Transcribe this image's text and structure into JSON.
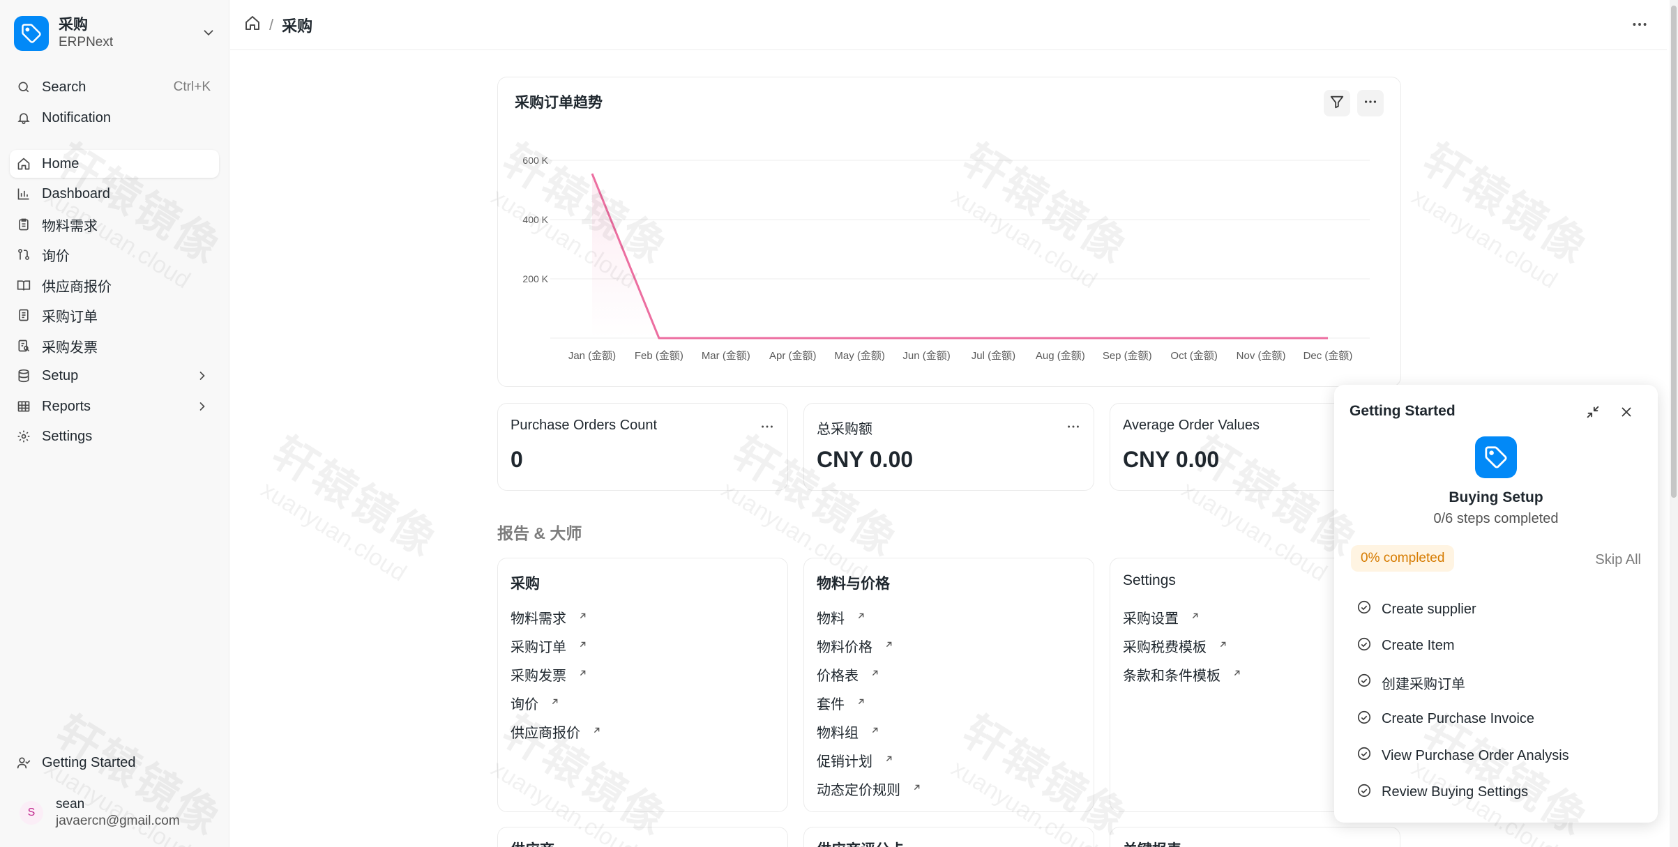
{
  "sidebar": {
    "app_title": "采购",
    "app_subtitle": "ERPNext",
    "search_label": "Search",
    "search_shortcut": "Ctrl+K",
    "notification_label": "Notification",
    "items": [
      {
        "label": "Home",
        "icon": "home-icon",
        "active": true
      },
      {
        "label": "Dashboard",
        "icon": "bar-chart-icon"
      },
      {
        "label": "物料需求",
        "icon": "clipboard-icon"
      },
      {
        "label": "询价",
        "icon": "git-compare-icon"
      },
      {
        "label": "供应商报价",
        "icon": "book-open-icon"
      },
      {
        "label": "采购订单",
        "icon": "file-text-icon"
      },
      {
        "label": "采购发票",
        "icon": "file-search-icon"
      },
      {
        "label": "Setup",
        "icon": "database-icon",
        "expandable": true
      },
      {
        "label": "Reports",
        "icon": "table-icon",
        "expandable": true
      },
      {
        "label": "Settings",
        "icon": "gear-icon"
      }
    ],
    "getting_started_label": "Getting Started",
    "user": {
      "initial": "S",
      "name": "sean",
      "email": "javaercn@gmail.com"
    }
  },
  "topbar": {
    "breadcrumb_current": "采购"
  },
  "chart": {
    "title": "采购订单趋势"
  },
  "chart_data": {
    "type": "line",
    "title": "采购订单趋势",
    "categories": [
      "Jan (金额)",
      "Feb (金额)",
      "Mar (金额)",
      "Apr (金额)",
      "May (金额)",
      "Jun (金额)",
      "Jul (金额)",
      "Aug (金额)",
      "Sep (金额)",
      "Oct (金额)",
      "Nov (金额)",
      "Dec (金额)"
    ],
    "values": [
      555000,
      0,
      0,
      0,
      0,
      0,
      0,
      0,
      0,
      0,
      0,
      0
    ],
    "y_ticks": [
      "200 K",
      "400 K",
      "600 K"
    ],
    "y_tick_values": [
      200000,
      400000,
      600000
    ],
    "ylim": [
      0,
      600000
    ],
    "grid": true,
    "color": "#ec6ea0"
  },
  "number_cards": [
    {
      "label": "Purchase Orders Count",
      "value": "0"
    },
    {
      "label": "总采购额",
      "value": "CNY 0.00"
    },
    {
      "label": "Average Order Values",
      "value": "CNY 0.00"
    }
  ],
  "section_heading": "报告 & 大师",
  "link_cards": [
    {
      "title": "采购",
      "links": [
        "物料需求",
        "采购订单",
        "采购发票",
        "询价",
        "供应商报价"
      ]
    },
    {
      "title": "物料与价格",
      "links": [
        "物料",
        "物料价格",
        "价格表",
        "套件",
        "物料组",
        "促销计划",
        "动态定价规则"
      ]
    },
    {
      "title": "Settings",
      "links": [
        "采购设置",
        "采购税费模板",
        "条款和条件模板"
      ]
    }
  ],
  "bottom_cards": [
    "供应商",
    "供应商评分卡",
    "关键报表"
  ],
  "getting_started": {
    "title": "Getting Started",
    "setup_title": "Buying Setup",
    "steps_text": "0/6 steps completed",
    "progress_text": "0% completed",
    "skip_label": "Skip All",
    "steps": [
      "Create supplier",
      "Create Item",
      "创建采购订单",
      "Create Purchase Invoice",
      "View Purchase Order Analysis",
      "Review Buying Settings"
    ]
  },
  "watermark": {
    "line1": "轩辕镜像",
    "line2": "xuanyuan.cloud"
  },
  "colors": {
    "accent": "#0289f7",
    "chart_line": "#ec6ea0",
    "progress_bg": "#fff4e2",
    "progress_text": "#d67b00"
  }
}
